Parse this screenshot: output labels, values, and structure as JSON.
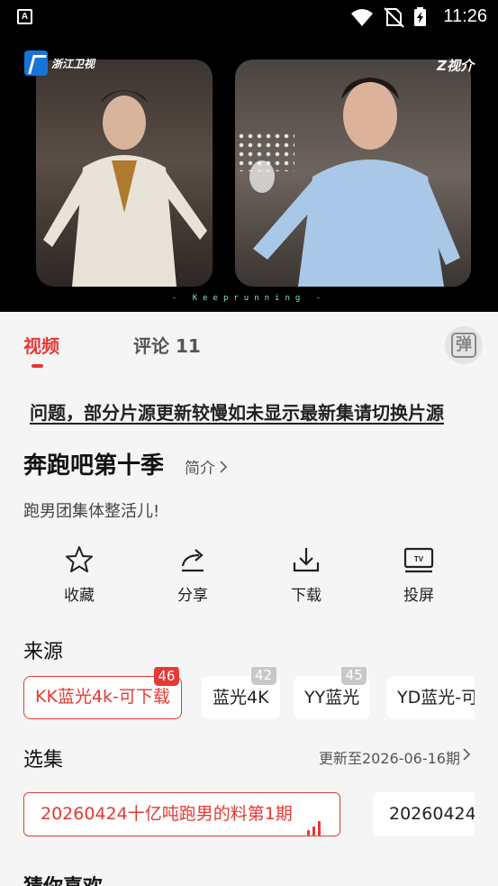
{
  "status_bar": {
    "notification_icon": "A",
    "icons": [
      "wifi-icon",
      "no-sim-icon",
      "battery-charging-icon"
    ],
    "time": "11:26"
  },
  "player": {
    "channel_logo_left": "浙江卫视",
    "channel_logo_right": "Z视介",
    "caption": "- Keeprunning -"
  },
  "tabs": {
    "video": "视频",
    "comments": "评论 11",
    "danmaku_icon": "弹"
  },
  "notice": "问题，部分片源更新较慢如未显示最新集请切换片源",
  "show": {
    "title": "奔跑吧第十季",
    "intro_link": "简介",
    "subtitle": "跑男团集体整活儿!"
  },
  "actions": [
    {
      "label": "收藏",
      "icon": "star-icon"
    },
    {
      "label": "分享",
      "icon": "share-icon"
    },
    {
      "label": "下载",
      "icon": "download-icon"
    },
    {
      "label": "投屏",
      "icon": "tv-cast-icon"
    }
  ],
  "sources": {
    "title": "来源",
    "items": [
      {
        "label": "KK蓝光4k-可下载",
        "count": "46",
        "active": true
      },
      {
        "label": "蓝光4K",
        "count": "42",
        "active": false
      },
      {
        "label": "YY蓝光",
        "count": "45",
        "active": false
      },
      {
        "label": "YD蓝光-可",
        "count": "",
        "active": false
      }
    ]
  },
  "episodes": {
    "title": "选集",
    "update_text": "更新至2026-06-16期",
    "items": [
      {
        "label": "20260424十亿吨跑男的料第1期",
        "active": true
      },
      {
        "label": "20260424",
        "active": false
      }
    ]
  },
  "recommend_title": "猜你喜欢",
  "colors": {
    "accent": "#e53935",
    "background": "#f5f5f5",
    "badge_gray": "#c8c8c8",
    "player_bg": "#000000"
  }
}
